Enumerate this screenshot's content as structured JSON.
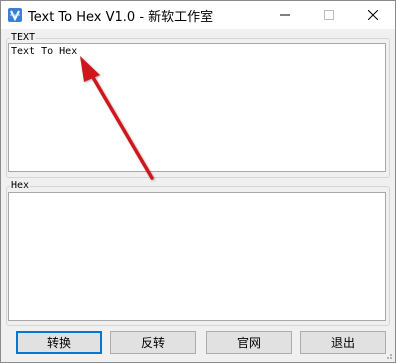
{
  "window": {
    "title": "Text To Hex V1.0 - 新软工作室",
    "colors": {
      "accent": "#0078d7",
      "arrow": "#d0171b"
    }
  },
  "text_group": {
    "label": "TEXT",
    "value": "Text To Hex"
  },
  "hex_group": {
    "label": "Hex",
    "value": ""
  },
  "buttons": {
    "convert": "转换",
    "reverse": "反转",
    "website": "官网",
    "exit": "退出"
  },
  "icons": [
    "app-icon",
    "minimize-icon",
    "maximize-icon",
    "close-icon",
    "size-grip-icon"
  ]
}
